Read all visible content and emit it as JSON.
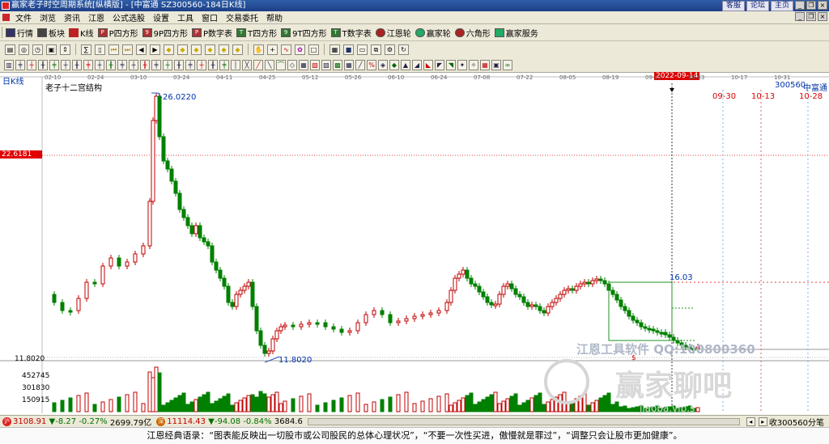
{
  "window": {
    "title": "赢家老子时空周期系统[纵横版] - [中富通  SZ300560-184日K线]",
    "links": [
      "客服",
      "论坛",
      "主页"
    ]
  },
  "menu": [
    "文件",
    "浏览",
    "资讯",
    "江恩",
    "公式选股",
    "设置",
    "工具",
    "窗口",
    "交易委托",
    "帮助"
  ],
  "toolbar1": [
    "行情",
    "板块",
    "K线",
    "P四方形",
    "9P四方形",
    "P数字表",
    "T四方形",
    "9T四方形",
    "T数字表",
    "江恩轮",
    "赢家轮",
    "六角形",
    "赢家服务"
  ],
  "chart": {
    "period_label": "日K线",
    "indicator_name": "老子十二宫结构",
    "stock_code": "300560",
    "stock_name": "中富通",
    "cursor_date": "2022-09-14",
    "price_marker": "22.6181",
    "axis_low": "11.8020",
    "high_label": "26.0220",
    "low_label": "11.8020",
    "box_top_label": "16.03",
    "date_labels": [
      "02-10",
      "02-24",
      "03-10",
      "03-24",
      "04-11",
      "04-25",
      "05-12",
      "05-26",
      "06-10",
      "06-24",
      "07-08",
      "07-22",
      "08-05",
      "08-19",
      "09-02",
      "10-03",
      "10-17",
      "10-31"
    ],
    "future_dates": [
      "09-30",
      "10-13",
      "10-28"
    ],
    "volume_ticks": [
      "452745",
      "301830",
      "150915"
    ],
    "watermark_text": "江恩工具软件 QQ:100800360",
    "watermark_brand": "赢家聊吧",
    "watermark_url": "jiaoba.vip.s"
  },
  "status": {
    "sh_index": "3108.91",
    "sh_change": "▼-8.27",
    "sh_pct": "-0.27%",
    "sh_vol": "2699.79亿",
    "sz_index": "11114.43",
    "sz_change": "▼-94.08",
    "sz_pct": "-0.84%",
    "sz_vol": "3684.6",
    "badge1": "沪",
    "badge2": "深",
    "right_text": "收300560分笔"
  },
  "quote": "江恩经典语录：“图表能反映出一切股市或公司股民的总体心理状况”，“不要一次性买进，傲慢就是罪过”，“调整只会让股市更加健康”。",
  "colors": {
    "up": "#c00000",
    "down": "#008000",
    "price_marker": "#e00000"
  }
}
